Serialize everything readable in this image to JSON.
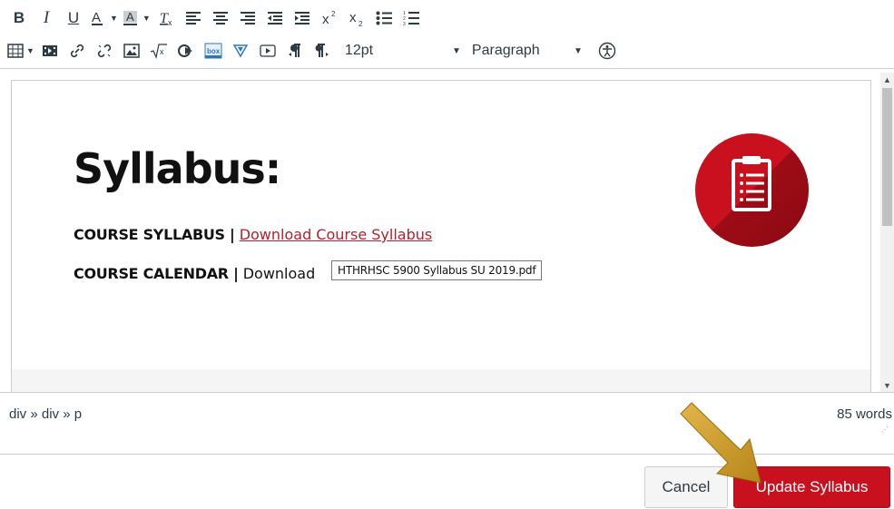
{
  "toolbar": {
    "row1": [
      "bold",
      "italic",
      "underline",
      "text-color",
      "background-color",
      "clear-formatting",
      "align-left",
      "align-center",
      "align-right",
      "outdent",
      "indent",
      "superscript",
      "subscript",
      "bullet-list",
      "numbered-list"
    ],
    "bold_label": "B",
    "italic_label": "I",
    "underline_label": "U",
    "font_size": "12pt",
    "block_format": "Paragraph"
  },
  "editor": {
    "heading": "Syllabus:",
    "line1_label": "COURSE SYLLABUS |",
    "line1_link": "Download Course Syllabus",
    "line2_label": "COURSE CALENDAR |",
    "line2_text": "Download",
    "tooltip": "HTHRHSC 5900 Syllabus SU 2019.pdf"
  },
  "status": {
    "path": "div » div » p",
    "word_count": "85 words"
  },
  "actions": {
    "cancel_label": "Cancel",
    "update_label": "Update Syllabus"
  },
  "colors": {
    "accent": "#c8101e",
    "link": "#b0202f",
    "arrow": "#d4a017"
  }
}
